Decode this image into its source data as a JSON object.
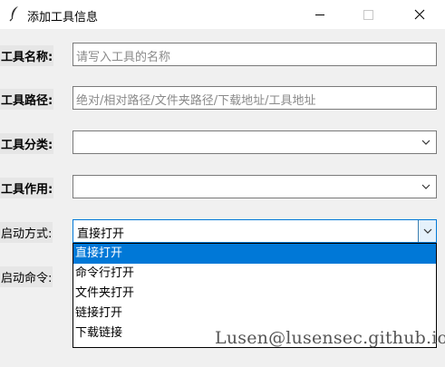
{
  "window": {
    "title": "添加工具信息"
  },
  "form": {
    "tool_name": {
      "label": "工具名称:",
      "placeholder": "请写入工具的名称"
    },
    "tool_path": {
      "label": "工具路径:",
      "placeholder": "绝对/相对路径/文件夹路径/下载地址/工具地址"
    },
    "tool_category": {
      "label": "工具分类:",
      "value": ""
    },
    "tool_usage": {
      "label": "工具作用:",
      "value": ""
    },
    "launch_mode": {
      "label": "启动方式:",
      "value": "直接打开",
      "options": [
        "直接打开",
        "命令行打开",
        "文件夹打开",
        "链接打开",
        "下载链接"
      ],
      "selected_index": 0
    },
    "launch_command": {
      "label": "启动命令:"
    }
  },
  "watermark": "Lusen@lusensec.github.io",
  "colors": {
    "selection": "#0078d7",
    "background": "#f0f0f0"
  }
}
